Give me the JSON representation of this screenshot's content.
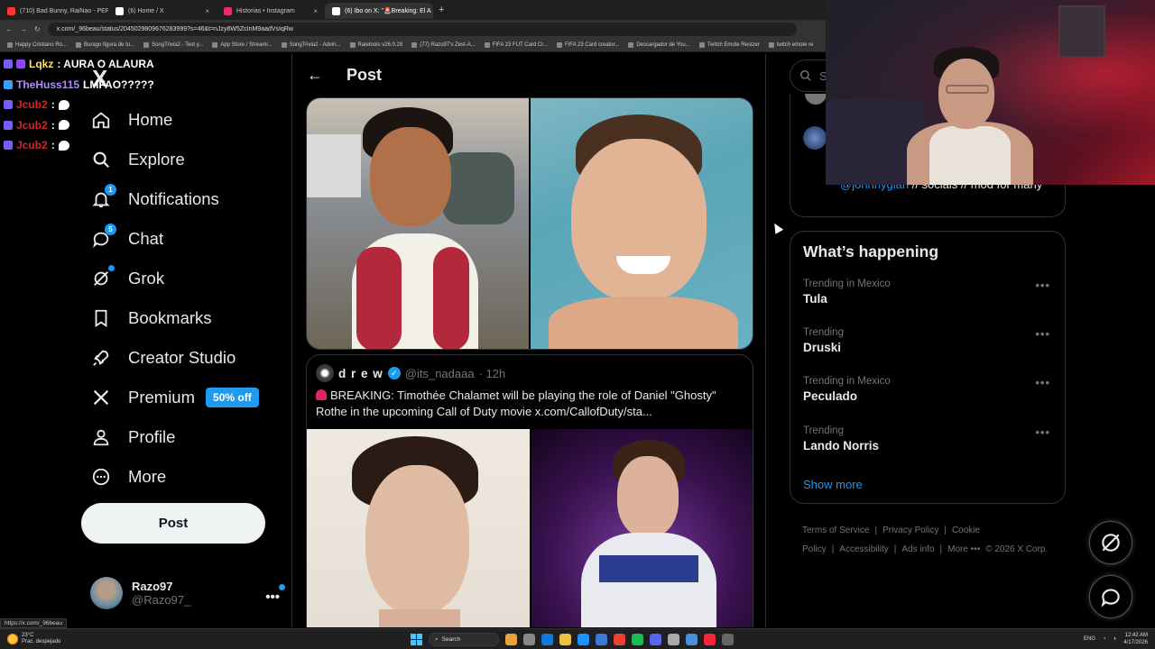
{
  "browser": {
    "tabs": [
      {
        "title": "(710) Bad Bunny, RaiNao - PERR",
        "color": "#ff3333",
        "active": false
      },
      {
        "title": "(6) Home / X",
        "color": "#ffffff",
        "active": false
      },
      {
        "title": "Historias • Instagram",
        "color": "#e1306c",
        "active": false
      },
      {
        "title": "(6) Ibo on X: \"🚨Breaking: El A",
        "color": "#ffffff",
        "active": true
      }
    ],
    "url": "x.com/_96beau/status/2045029809676283999?s=46&t=nJzy8W5ZcInM9aadVsIqRw",
    "bookmarks": [
      "Happy Cristiano Ro...",
      "Burago figura de to...",
      "SongTrivia2 - Test y...",
      "App Store / Streami...",
      "SongTrivia2 - Advin...",
      "Raletools v26.0.28",
      "(77) Razo97's Zest-A...",
      "FIFA 23 FUT Card Cr...",
      "FIFA 23 Card creator...",
      "Descargador de You...",
      "Twitch Emote Resizer",
      "twitch emote re"
    ]
  },
  "chat_overlay": [
    {
      "user": "Lqkz",
      "message": ": AURA O ALAURA",
      "style": "lqkz"
    },
    {
      "user": "TheHuss115",
      "message": "LMFAO?????",
      "style": "huss"
    },
    {
      "user": "Jcub2",
      "message": ":",
      "style": "jcub"
    },
    {
      "user": "Jcub2",
      "message": ":",
      "style": "jcub"
    },
    {
      "user": "Jcub2",
      "message": ":",
      "style": "jcub"
    }
  ],
  "nav": {
    "logo": "X",
    "items": [
      {
        "label": "Home",
        "icon": "home-icon",
        "badge": ""
      },
      {
        "label": "Explore",
        "icon": "search-icon",
        "badge": ""
      },
      {
        "label": "Notifications",
        "icon": "bell-icon",
        "badge": "1"
      },
      {
        "label": "Chat",
        "icon": "chat-icon",
        "badge": "5"
      },
      {
        "label": "Grok",
        "icon": "grok-icon",
        "badge": "dot"
      },
      {
        "label": "Bookmarks",
        "icon": "bookmark-icon",
        "badge": ""
      },
      {
        "label": "Creator Studio",
        "icon": "rocket-icon",
        "badge": ""
      },
      {
        "label": "Premium",
        "icon": "x-icon",
        "badge": "",
        "pill": "50% off"
      },
      {
        "label": "Profile",
        "icon": "person-icon",
        "badge": ""
      },
      {
        "label": "More",
        "icon": "more-circle-icon",
        "badge": ""
      }
    ],
    "post_button": "Post",
    "account": {
      "name": "Razo97",
      "handle": "@Razo97_",
      "more": "•••"
    }
  },
  "main": {
    "header_title": "Post",
    "back_icon": "arrow-left-icon",
    "quote": {
      "name": "d r e w",
      "handle": "@its_nadaaa",
      "time": "· 12h",
      "text": "BREAKING: Timothée Chalamet will be playing the role of Daniel \"Ghosty\" Rothe in the upcoming Call of Duty movie  x.com/CallofDuty/sta..."
    }
  },
  "right": {
    "search_placeholder": "Se",
    "who_bio_link": "@johnnyglan",
    "who_bio_text": " // socials // mod for many",
    "happening_title": "What’s happening",
    "trends": [
      {
        "meta": "Trending in Mexico",
        "name": "Tula"
      },
      {
        "meta": "Trending",
        "name": "Druski"
      },
      {
        "meta": "Trending in Mexico",
        "name": "Peculado"
      },
      {
        "meta": "Trending",
        "name": "Lando Norris"
      }
    ],
    "trend_more": "•••",
    "show_more": "Show more",
    "footer": [
      "Terms of Service",
      "|",
      "Privacy Policy",
      "|",
      "Cookie Policy",
      "|",
      "Accessibility",
      "|",
      "Ads info",
      "|",
      "More •••",
      "© 2026 X Corp."
    ]
  },
  "status_url": "https://x.com/_96beau",
  "taskbar": {
    "weather_temp": "23°C",
    "weather_desc": "Prac. despejado",
    "search": "Search",
    "lang": "ENG",
    "time": "12:42 AM",
    "date": "4/17/2026"
  },
  "colors": {
    "accent": "#1d9bf0",
    "background": "#000000",
    "border": "#2f3336",
    "muted": "#71767b"
  }
}
